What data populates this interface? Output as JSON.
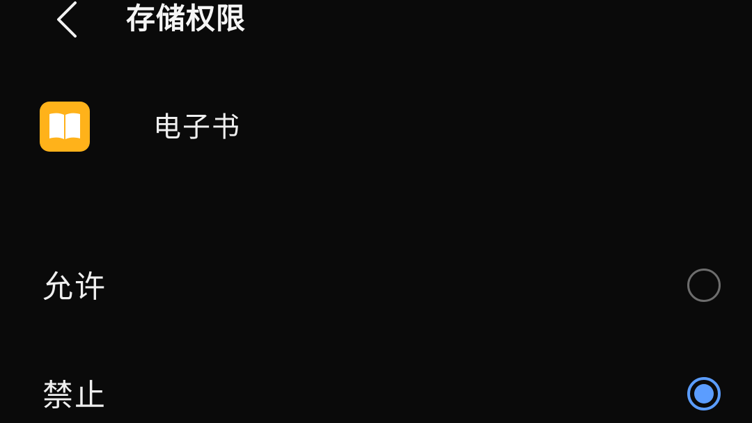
{
  "header": {
    "title": "存储权限",
    "back_icon": "chevron-left-icon"
  },
  "app": {
    "name": "电子书",
    "icon": "book-icon",
    "icon_color": "#ffb21a"
  },
  "options": [
    {
      "label": "允许",
      "selected": false
    },
    {
      "label": "禁止",
      "selected": true
    }
  ],
  "colors": {
    "background": "#0a0a0a",
    "accent": "#5b9dff",
    "text": "#efefef"
  }
}
